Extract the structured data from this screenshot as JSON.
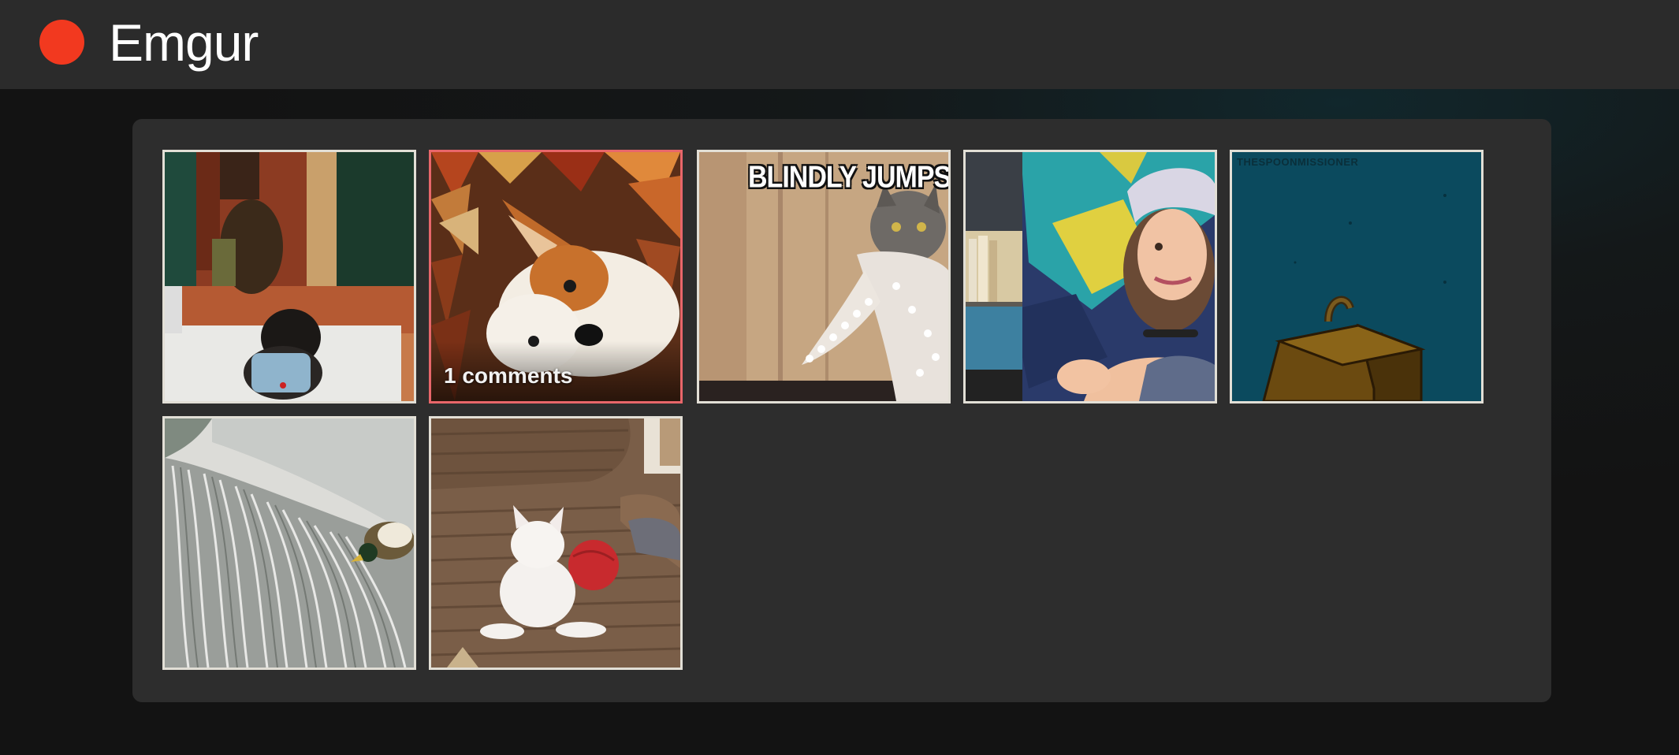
{
  "app": {
    "title": "Emgur",
    "brand_color": "#f2391f"
  },
  "gallery": {
    "items": [
      {
        "alt": "small dog on cushion",
        "icon": "dog-photo"
      },
      {
        "alt": "corgi puppy in autumn leaves",
        "icon": "puppy-photo",
        "caption": "1 comments",
        "selected": true
      },
      {
        "alt": "cat in scarf meme",
        "icon": "cat-meme",
        "meme_text": "BLINDLY JUMPS IN"
      },
      {
        "alt": "girl smiling in front of bookshelf",
        "icon": "girl-photo"
      },
      {
        "alt": "bag cartoon",
        "icon": "cartoon-bag",
        "watermark": "THESPOONMISSIONER"
      },
      {
        "alt": "duck at waterfall",
        "icon": "duck-photo"
      },
      {
        "alt": "white kitten with yarn ball",
        "icon": "kitten-photo"
      }
    ]
  }
}
